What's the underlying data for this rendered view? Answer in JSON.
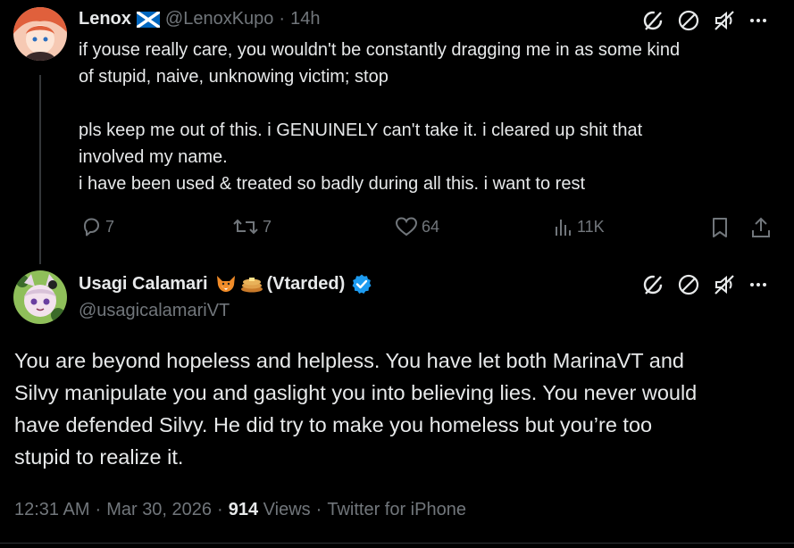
{
  "tweet1": {
    "name": "Lenox",
    "flag_emoji": "🏴󠁧󠁢󠁳󠁣󠁴󠁿",
    "handle": "@LenoxKupo",
    "sep": "·",
    "time": "14h",
    "lines": [
      "if youse really care, you wouldn't be constantly dragging me in as some kind",
      "of stupid, naive, unknowing victim; stop",
      "pls keep me out of this. i GENUINELY can't take it. i cleared up shit that",
      "involved my name.",
      "i have been used & treated so badly during all this. i want to rest"
    ],
    "replies": "7",
    "retweets": "7",
    "likes": "64",
    "views": "11K"
  },
  "tweet2": {
    "name": "Usagi Calamari",
    "name_suffix": "(Vtarded)",
    "emojis": "🦊🥞",
    "handle": "@usagicalamariVT",
    "lines": [
      "You are beyond hopeless and helpless. You have let both MarinaVT and",
      "Silvy manipulate you and gaslight you into believing lies. You never would",
      "have defended Silvy. He did try to make you homeless but you’re too",
      "stupid to realize it."
    ],
    "time": "12:31 AM",
    "date": "Mar 30, 2026",
    "dot": "·",
    "views_count": "914",
    "views_label": "Views",
    "client": "Twitter for iPhone"
  },
  "colors": {
    "background": "#000000",
    "text": "#e7e9ea",
    "muted": "#71767b",
    "verified": "#1d9bf0"
  }
}
